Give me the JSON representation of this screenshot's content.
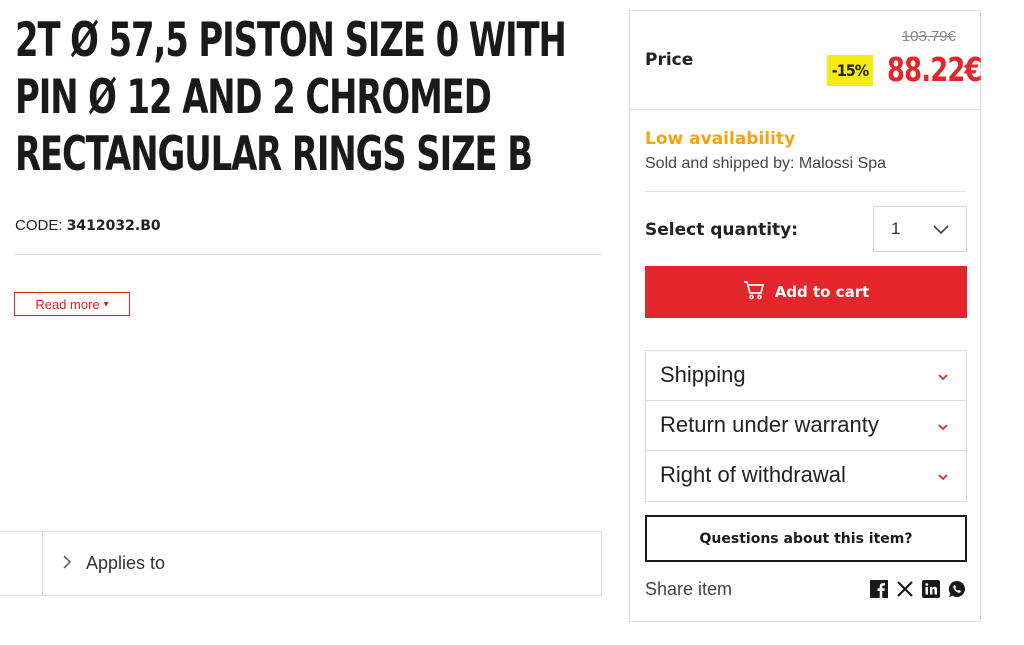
{
  "product": {
    "title": "2T Ø 57,5 PISTON SIZE 0 WITH PIN Ø 12 AND 2 CHROMED RECTANGULAR RINGS SIZE B",
    "code_label": "CODE:",
    "code_value": "3412032.B0",
    "read_more_label": "Read more",
    "read_more_arrow": "▾",
    "applies_to_label": "Applies to"
  },
  "purchase": {
    "price_label": "Price",
    "old_price": "103.79€",
    "discount": "-15%",
    "new_price": "88.22€",
    "availability": "Low availability",
    "sold_by": "Sold and shipped by: Malossi Spa",
    "quantity_label": "Select quantity:",
    "quantity_value": "1",
    "add_to_cart_label": "Add to cart",
    "questions_label": "Questions about this item?",
    "share_label": "Share item",
    "accent_color": "#e3262c",
    "availability_color": "#f5a40e",
    "discount_color": "#f5ec14"
  },
  "accordion": [
    {
      "label": "Shipping"
    },
    {
      "label": "Return under warranty"
    },
    {
      "label": "Right of withdrawal"
    }
  ],
  "social_icons": [
    "facebook-icon",
    "x-icon",
    "linkedin-icon",
    "whatsapp-icon"
  ]
}
